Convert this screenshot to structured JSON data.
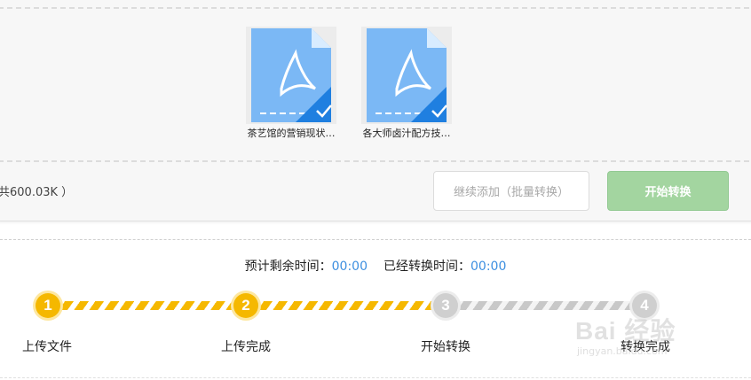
{
  "files": [
    {
      "name": "茶艺馆的营销现状…"
    },
    {
      "name": "各大师卤汁配方技…"
    }
  ],
  "summary": "共600.03K ）",
  "buttons": {
    "add_label": "继续添加（批量转换）",
    "start_label": "开始转换"
  },
  "timing": {
    "remaining_label": "预计剩余时间：",
    "remaining_value": "00:00",
    "elapsed_label": "已经转换时间：",
    "elapsed_value": "00:00"
  },
  "steps": [
    {
      "number": "1",
      "label": "上传文件",
      "state": "done"
    },
    {
      "number": "2",
      "label": "上传完成",
      "state": "done"
    },
    {
      "number": "3",
      "label": "开始转换",
      "state": "todo"
    },
    {
      "number": "4",
      "label": "转换完成",
      "state": "todo"
    }
  ],
  "watermark": {
    "logo": "Bai 经验",
    "url": "jingyan.baidu.com"
  },
  "colors": {
    "pdf_blue": "#7bb8f5",
    "check_blue": "#1f7fe0",
    "step_done": "#f5b800",
    "step_todo": "#cfcfcf",
    "start_button": "#a3d5a0",
    "timer_value": "#3d8fe0"
  },
  "icons": {
    "file": "pdf-file-icon",
    "selected": "check-corner-icon"
  }
}
